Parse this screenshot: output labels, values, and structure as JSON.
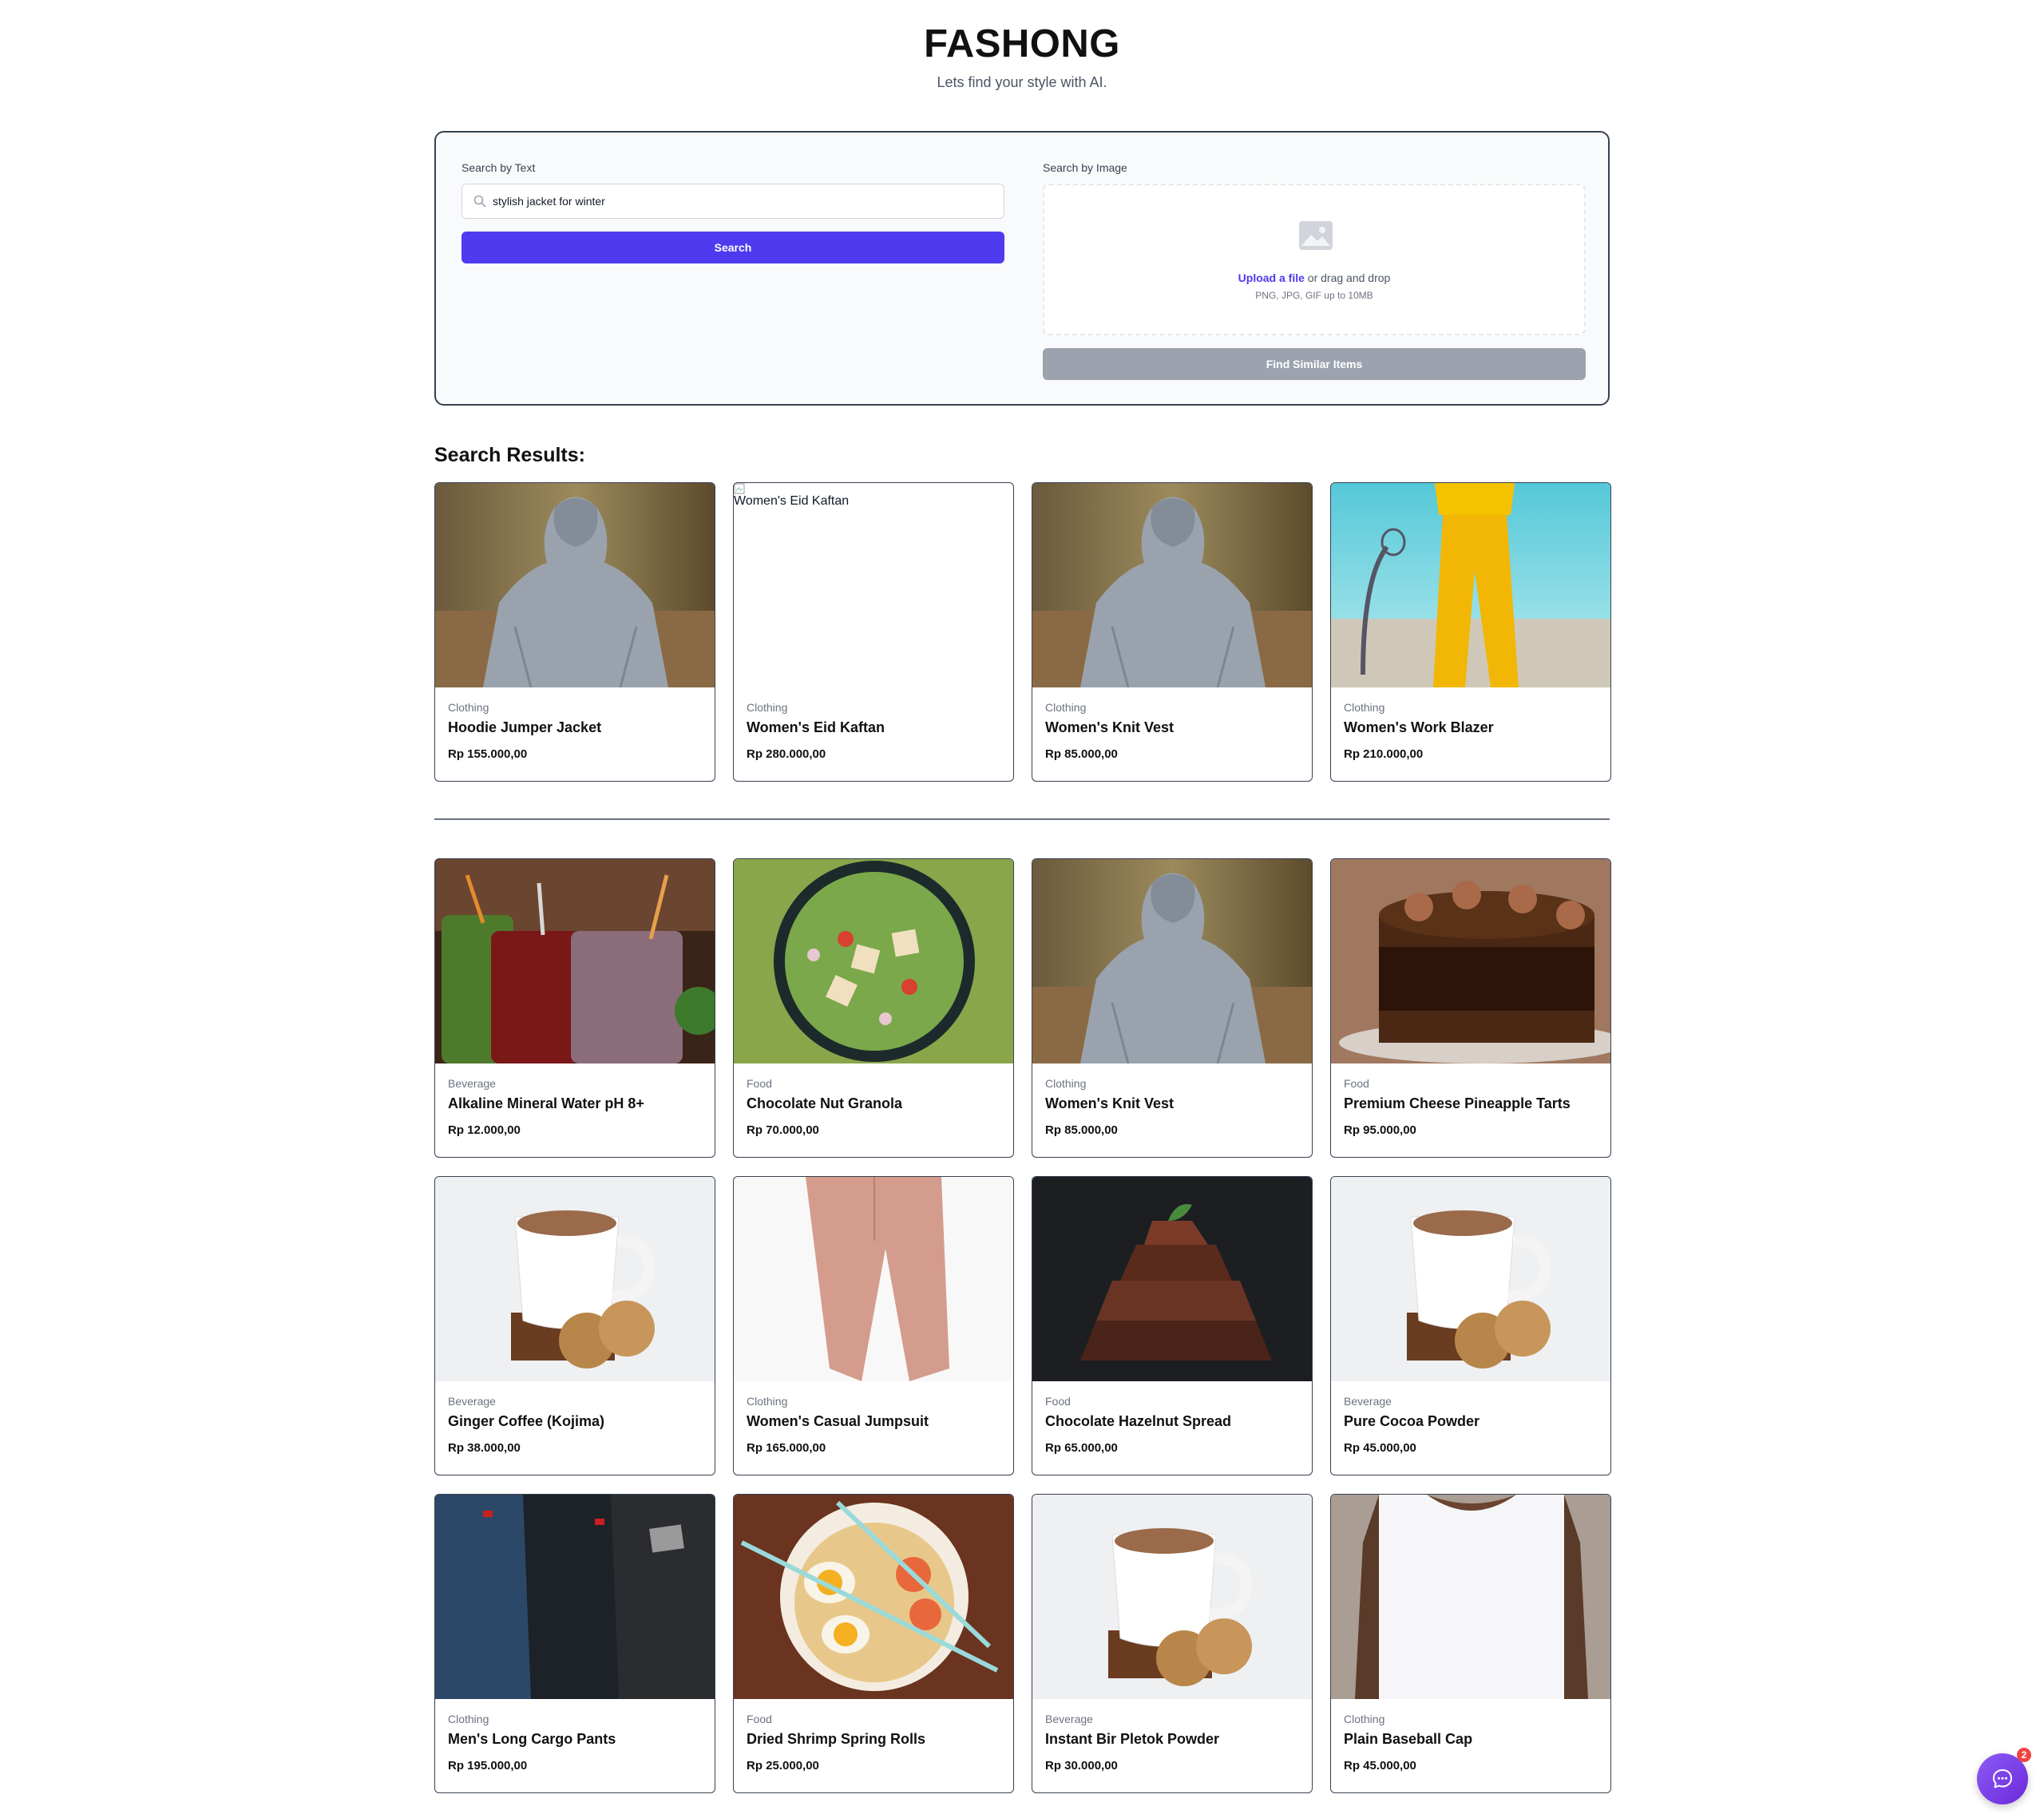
{
  "header": {
    "title": "FASHONG",
    "tagline": "Lets find your style with AI."
  },
  "search": {
    "text_label": "Search by Text",
    "text_value": "stylish jacket for winter",
    "search_button": "Search",
    "image_label": "Search by Image",
    "upload_link": "Upload a file",
    "upload_rest": " or drag and drop",
    "upload_hint": "PNG, JPG, GIF up to 10MB",
    "find_similar_button": "Find Similar Items"
  },
  "results": {
    "title": "Search Results:",
    "items": [
      {
        "category": "Clothing",
        "name": "Hoodie Jumper Jacket",
        "price": "Rp 155.000,00",
        "image": "hoodie"
      },
      {
        "category": "Clothing",
        "name": "Women's Eid Kaftan",
        "price": "Rp 280.000,00",
        "image": "broken",
        "alt": "Women's Eid Kaftan"
      },
      {
        "category": "Clothing",
        "name": "Women's Knit Vest",
        "price": "Rp 85.000,00",
        "image": "hoodie"
      },
      {
        "category": "Clothing",
        "name": "Women's Work Blazer",
        "price": "Rp 210.000,00",
        "image": "yellow-pants"
      }
    ]
  },
  "catalog": {
    "items": [
      {
        "category": "Beverage",
        "name": "Alkaline Mineral Water pH 8+",
        "price": "Rp 12.000,00",
        "image": "smoothies"
      },
      {
        "category": "Food",
        "name": "Chocolate Nut Granola",
        "price": "Rp 70.000,00",
        "image": "salad"
      },
      {
        "category": "Clothing",
        "name": "Women's Knit Vest",
        "price": "Rp 85.000,00",
        "image": "hoodie"
      },
      {
        "category": "Food",
        "name": "Premium Cheese Pineapple Tarts",
        "price": "Rp 95.000,00",
        "image": "cake"
      },
      {
        "category": "Beverage",
        "name": "Ginger Coffee (Kojima)",
        "price": "Rp 38.000,00",
        "image": "coffee"
      },
      {
        "category": "Clothing",
        "name": "Women's Casual Jumpsuit",
        "price": "Rp 165.000,00",
        "image": "pink-pants"
      },
      {
        "category": "Food",
        "name": "Chocolate Hazelnut Spread",
        "price": "Rp 65.000,00",
        "image": "chocolate"
      },
      {
        "category": "Beverage",
        "name": "Pure Cocoa Powder",
        "price": "Rp 45.000,00",
        "image": "coffee"
      },
      {
        "category": "Clothing",
        "name": "Men's Long Cargo Pants",
        "price": "Rp 195.000,00",
        "image": "jeans"
      },
      {
        "category": "Food",
        "name": "Dried Shrimp Spring Rolls",
        "price": "Rp 25.000,00",
        "image": "ramen"
      },
      {
        "category": "Beverage",
        "name": "Instant Bir Pletok Powder",
        "price": "Rp 30.000,00",
        "image": "coffee"
      },
      {
        "category": "Clothing",
        "name": "Plain Baseball Cap",
        "price": "Rp 45.000,00",
        "image": "tshirt"
      }
    ]
  },
  "chat": {
    "badge": "2"
  },
  "colors": {
    "primary": "#4f3af0",
    "disabled": "#9ca3af",
    "border": "#374151",
    "badge": "#ef4444"
  }
}
